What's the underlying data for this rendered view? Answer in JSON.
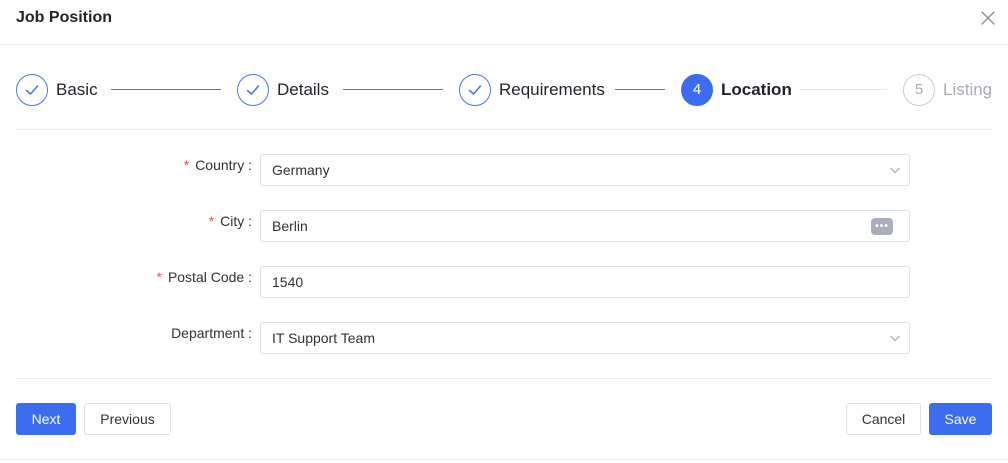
{
  "dialog": {
    "title": "Job Position"
  },
  "steps": [
    {
      "label": "Basic",
      "status": "done"
    },
    {
      "label": "Details",
      "status": "done"
    },
    {
      "label": "Requirements",
      "status": "done"
    },
    {
      "label": "Location",
      "status": "active",
      "number": "4"
    },
    {
      "label": "Listing",
      "status": "wait",
      "number": "5"
    }
  ],
  "form": {
    "country": {
      "label": "Country",
      "separator": ":",
      "required_mark": "*",
      "value": "Germany"
    },
    "city": {
      "label": "City",
      "separator": ":",
      "required_mark": "*",
      "value": "Berlin",
      "more_glyph": "•••"
    },
    "postal_code": {
      "label": "Postal Code",
      "separator": ":",
      "required_mark": "*",
      "value": "1540"
    },
    "department": {
      "label": "Department",
      "separator": ":",
      "value": "IT Support Team"
    }
  },
  "buttons": {
    "next": "Next",
    "previous": "Previous",
    "cancel": "Cancel",
    "save": "Save"
  },
  "colors": {
    "primary": "#3c6cf0",
    "step_done": "#4a76d3",
    "required": "#e45656",
    "wait": "#a8abb2"
  }
}
